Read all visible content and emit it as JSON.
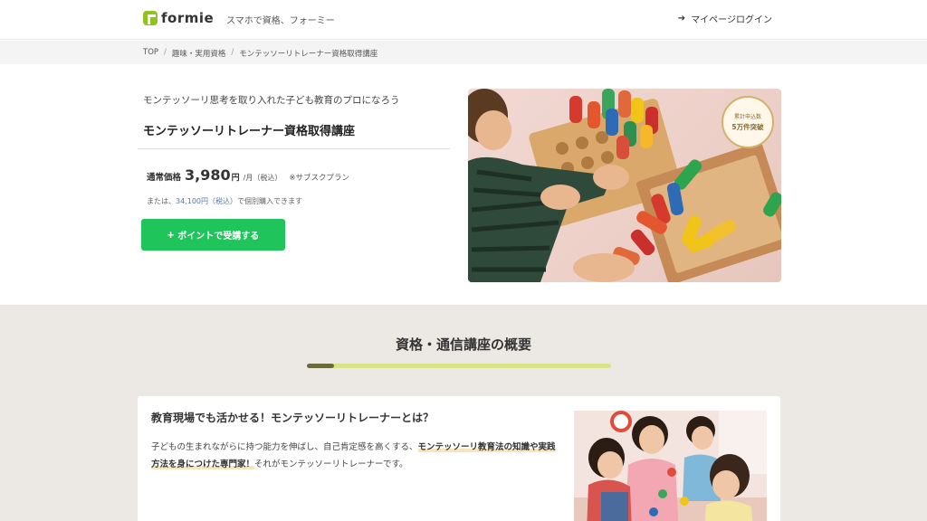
{
  "header": {
    "logo_text": "formie",
    "tagline": "スマホで資格、フォーミー",
    "mypage_icon": "login-icon",
    "mypage_label": "マイページログイン"
  },
  "breadcrumb": {
    "items": [
      "TOP",
      "趣味・実用資格",
      "モンテッソーリトレーナー資格取得講座"
    ],
    "separator": "/"
  },
  "hero": {
    "subtitle": "モンテッソーリ思考を取り入れた子ども教育のプロになろう",
    "title": "モンテッソーリトレーナー資格取得講座",
    "price_label": "通常価格",
    "price_value": "3,980",
    "price_unit": "円",
    "price_per": "/月（税込）",
    "price_plan": "※サブスクプラン",
    "buy_note_prefix": "または、",
    "buy_note_price": "34,100円（税込）",
    "buy_note_suffix": "で個別購入できます",
    "button_plus": "+",
    "button_label": "ポイントで受講する",
    "badge_top": "累計申込数",
    "badge_main": "5万件突破"
  },
  "overview": {
    "section_title": "資格・通信講座の概要",
    "progress_fraction": 0.09,
    "card_title": "教育現場でも活かせる！モンテッソーリトレーナーとは？",
    "card_text_1": "子どもの生まれながらに持つ能力を伸ばし、自己肯定感を高くする、",
    "card_text_hl": "モンテッソーリ教育法の知識や実践方法を身につけた専門家！",
    "card_text_2": "それがモンテッソーリトレーナーです。"
  },
  "colors": {
    "brand_green": "#8fc31f",
    "cta_green": "#1fc45a",
    "progress_track": "#d9e48a",
    "progress_fill": "#6b6a3a",
    "section_bg": "#ece9e5"
  }
}
